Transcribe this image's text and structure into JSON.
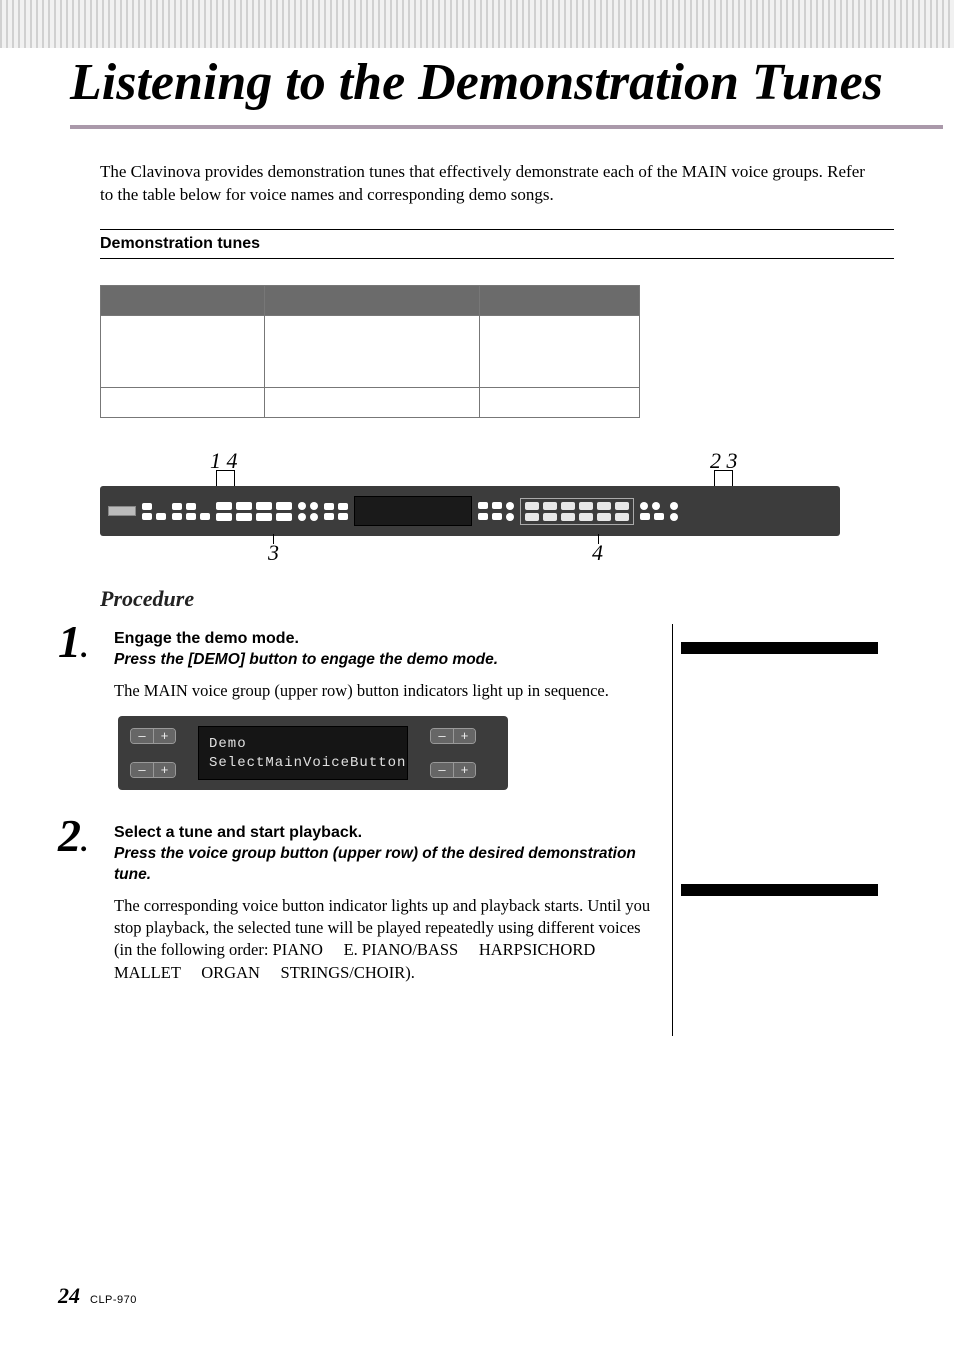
{
  "page": {
    "title": "Listening to the Demonstration Tunes",
    "intro": "The Clavinova provides demonstration tunes that effectively demonstrate each of the MAIN voice groups. Refer to the table below for voice names and corresponding demo songs.",
    "section_heading": "Demonstration tunes",
    "procedure_heading": "Procedure"
  },
  "panel_callouts": {
    "top_left": "1 4",
    "top_right": "2 3",
    "bottom_left": "3",
    "bottom_right": "4"
  },
  "steps": [
    {
      "num": "1",
      "title": "Engage the demo mode.",
      "instruction": "Press the [DEMO] button to engage the demo mode.",
      "body": "The MAIN voice group (upper row) button indicators light up in sequence."
    },
    {
      "num": "2",
      "title": "Select a tune and start playback.",
      "instruction": "Press the voice group button (upper row) of the desired demonstration tune.",
      "body": "The corresponding voice button indicator lights up and playback starts. Until you stop playback, the selected tune will be played repeatedly using different voices (in the following order: PIANO     E. PIANO/BASS     HARPSICHORD     MALLET     ORGAN     STRINGS/CHOIR)."
    }
  ],
  "lcd": {
    "line1": "Demo",
    "line2": "SelectMainVoiceButton",
    "minus": "–",
    "plus": "+"
  },
  "footer": {
    "page_number": "24",
    "model": "CLP-970"
  }
}
